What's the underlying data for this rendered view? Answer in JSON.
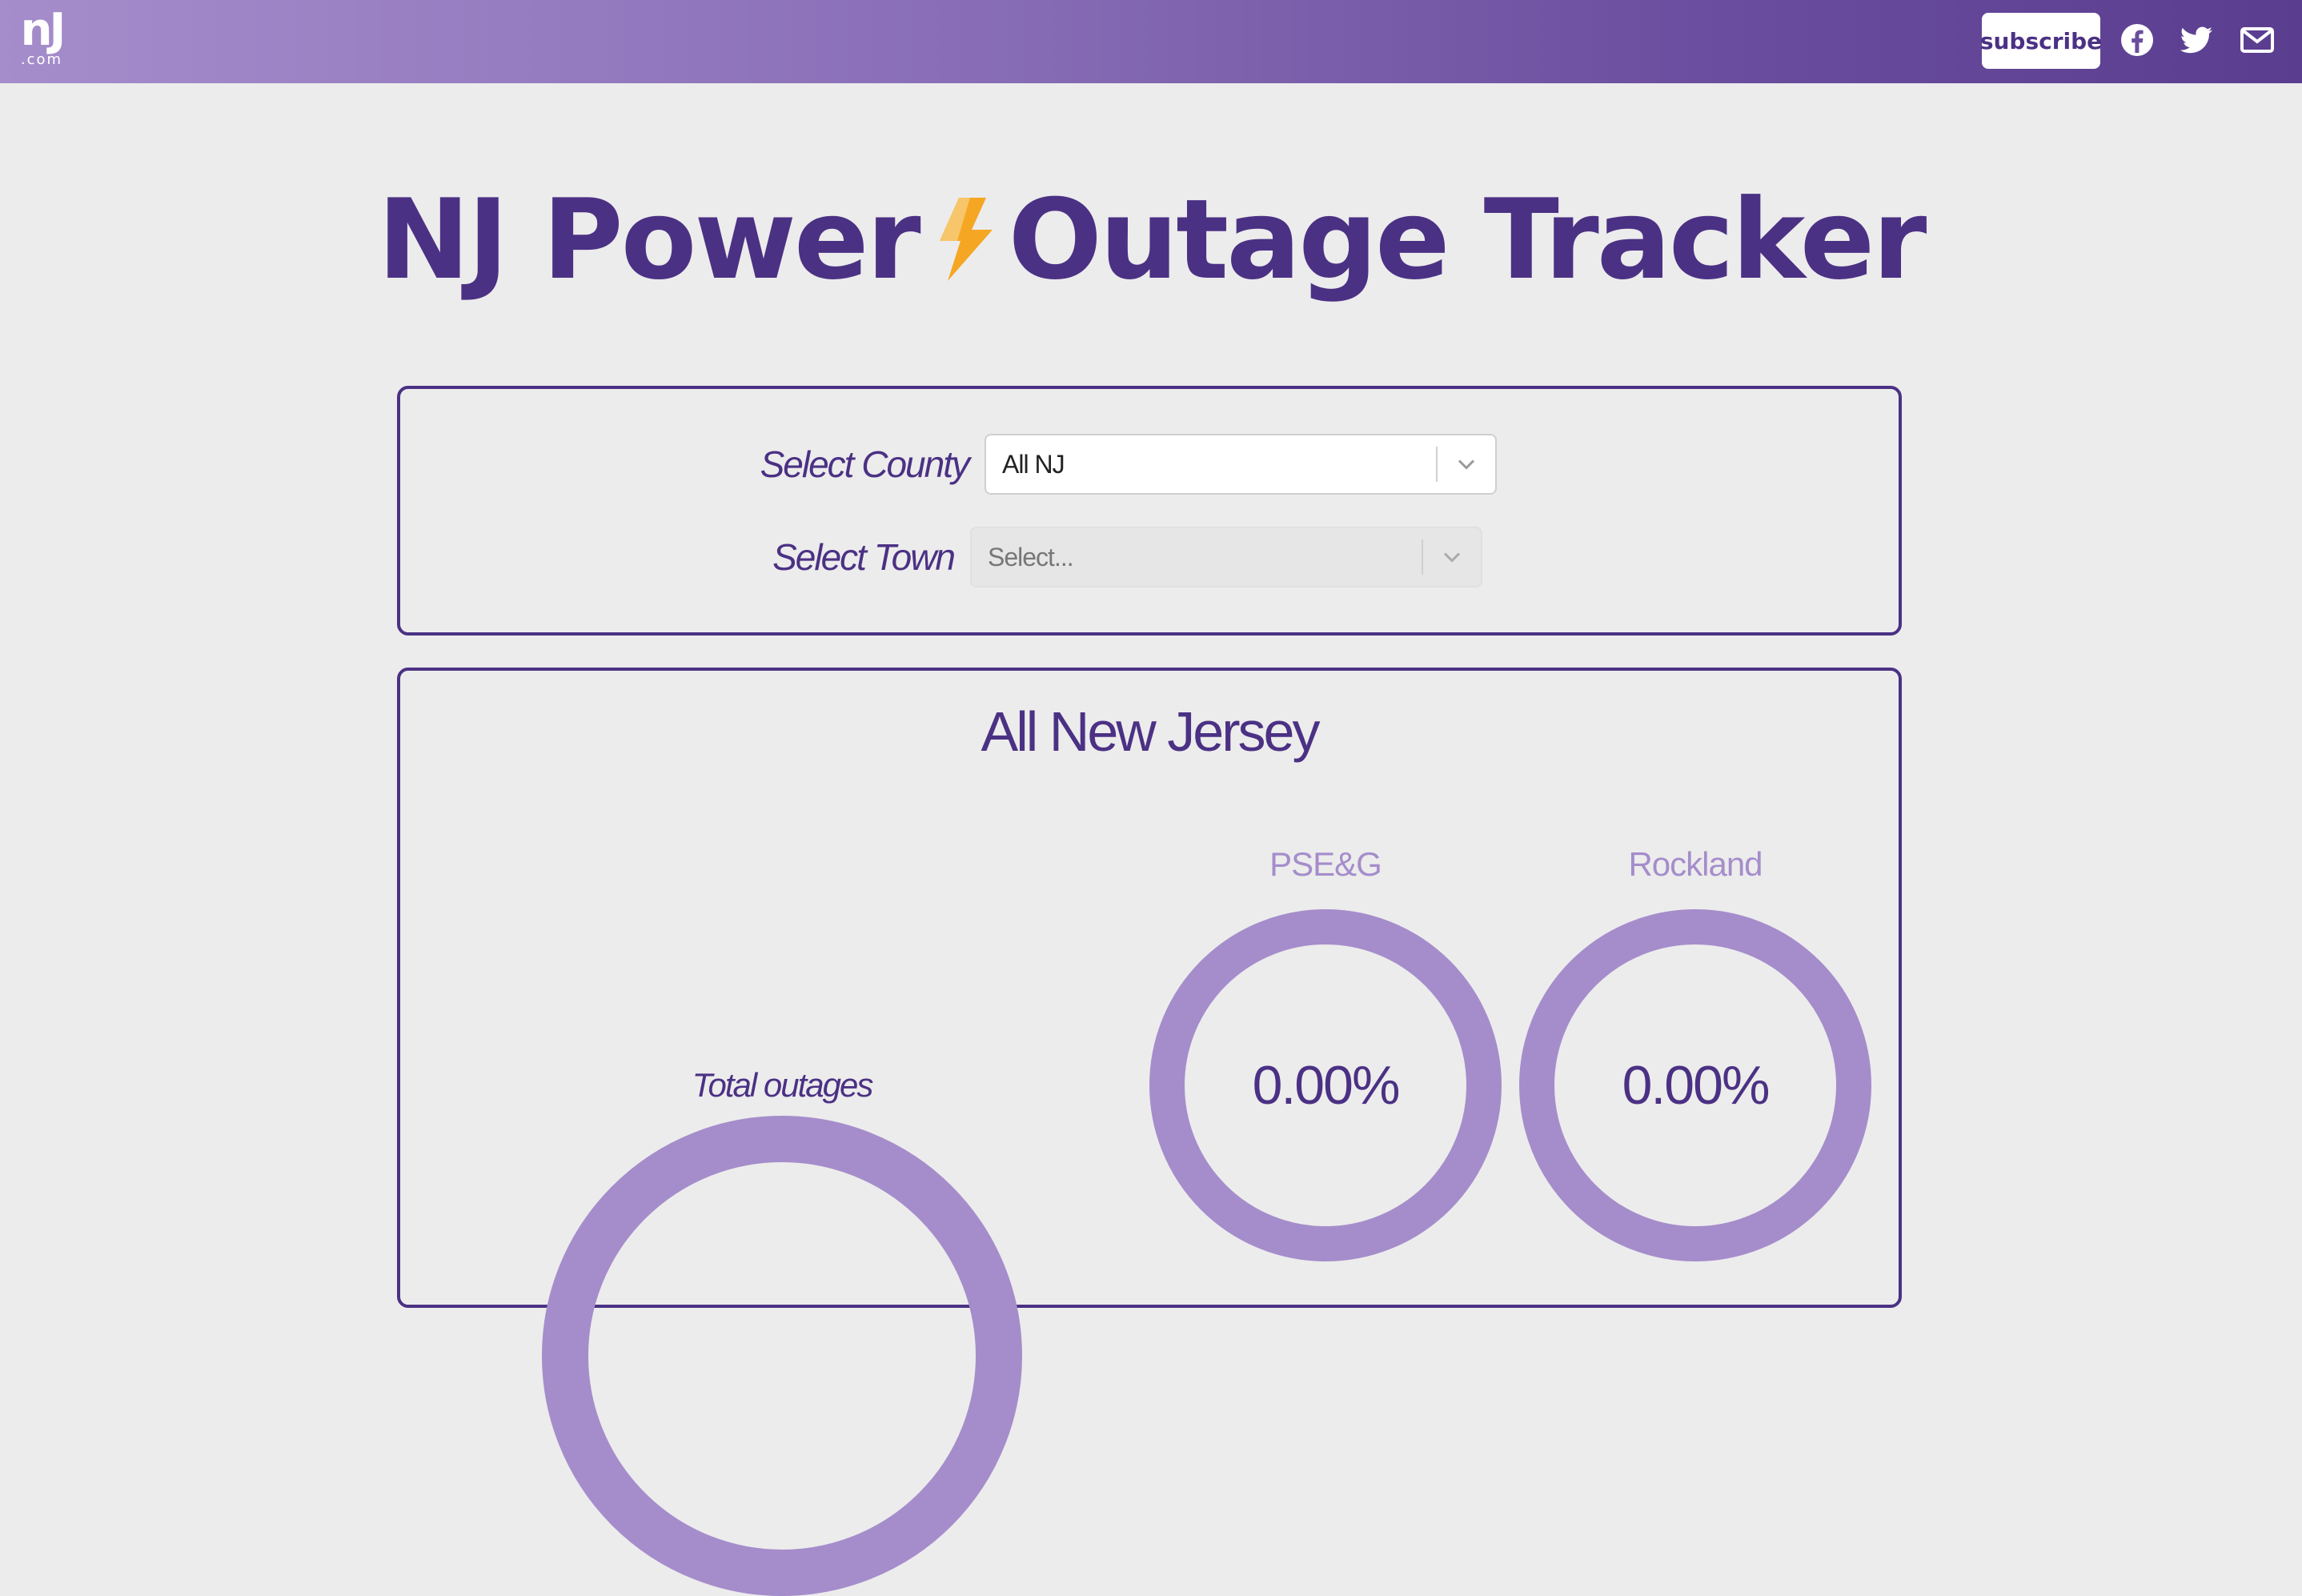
{
  "header": {
    "logo": {
      "main": "nJ",
      "sub": ".com"
    },
    "subscribe_label": "subscribe",
    "social_icons": [
      "facebook-icon",
      "twitter-icon",
      "mail-icon"
    ]
  },
  "page": {
    "title_part1": "NJ Power",
    "title_icon": "lightning-bolt-icon",
    "title_part2": "Outage Tracker"
  },
  "filters": {
    "county": {
      "label": "Select County",
      "value": "All NJ"
    },
    "town": {
      "label": "Select Town",
      "placeholder": "Select..."
    }
  },
  "results": {
    "title": "All New Jersey",
    "total": {
      "label": "Total outages"
    },
    "utilities": [
      {
        "name": "PSE&G",
        "value": "0.00%"
      },
      {
        "name": "Rockland",
        "value": "0.00%"
      }
    ]
  },
  "colors": {
    "brand_purple": "#4b3184",
    "light_purple": "#a58dcb",
    "bolt_orange": "#f5a623",
    "background": "#ececec"
  }
}
